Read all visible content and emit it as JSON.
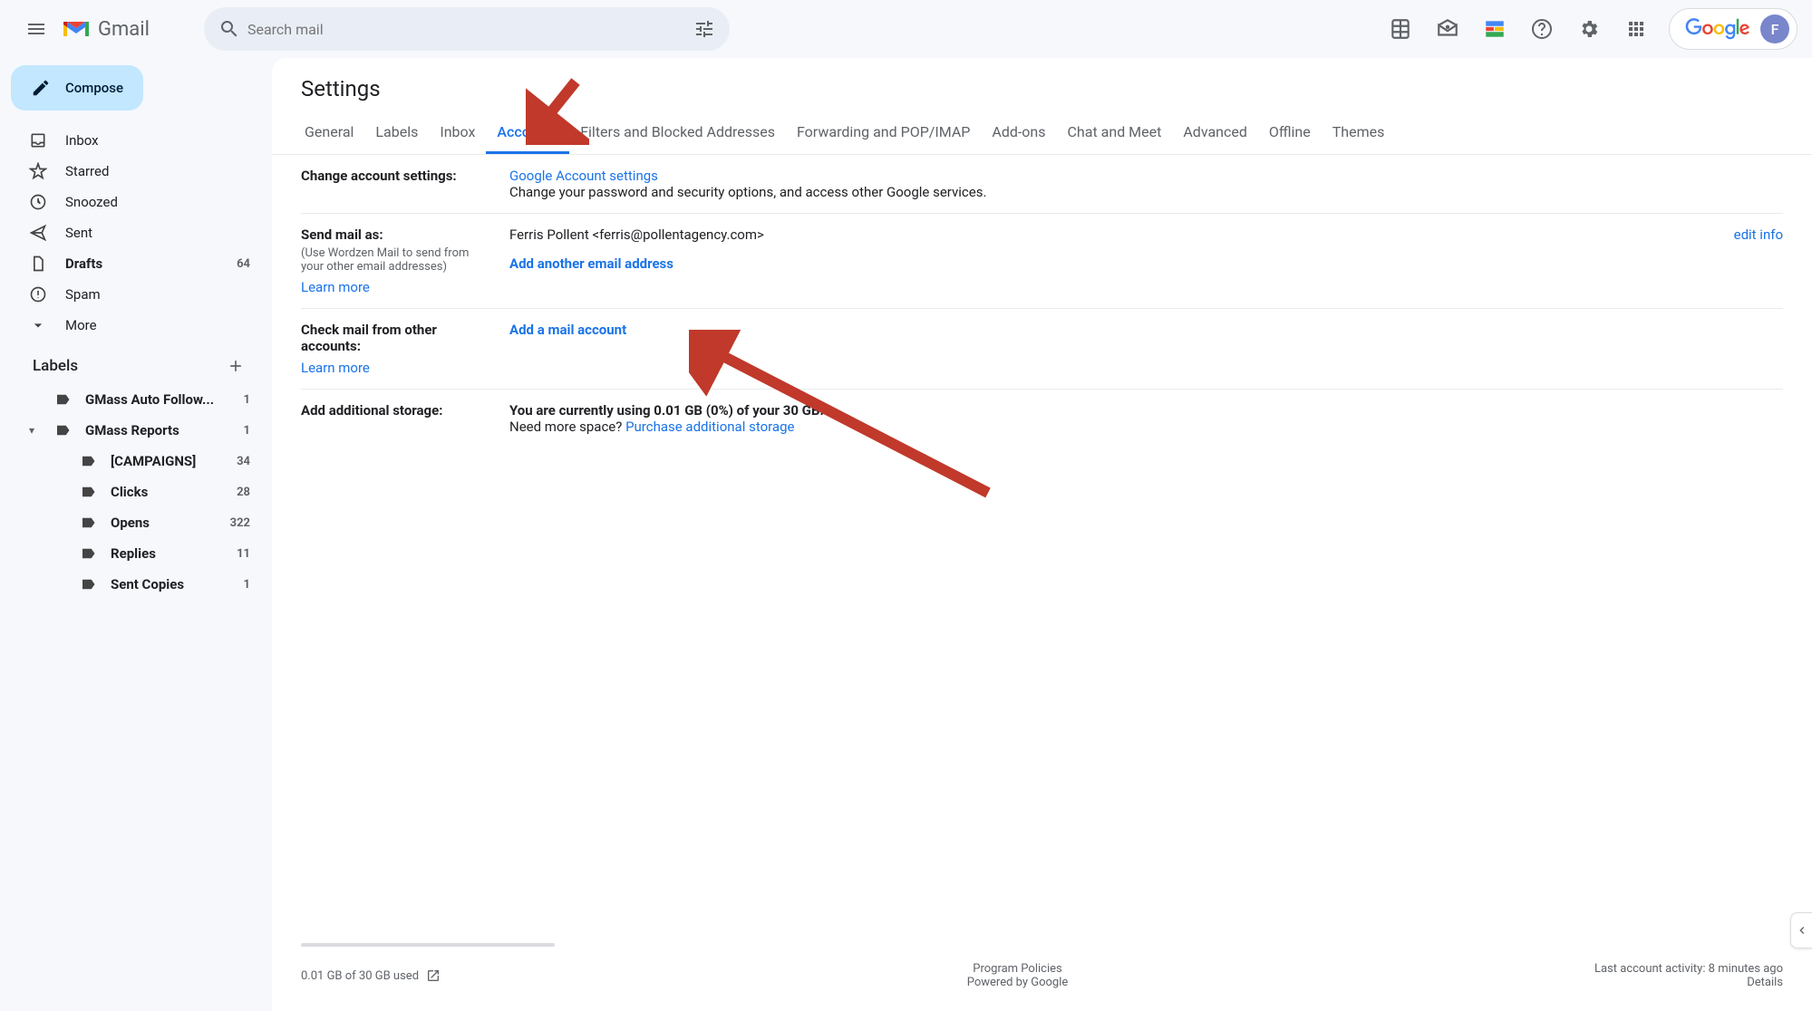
{
  "header": {
    "app_name": "Gmail",
    "search_placeholder": "Search mail",
    "google_text": "Google",
    "avatar_initial": "F"
  },
  "sidebar": {
    "compose": "Compose",
    "nav": [
      {
        "icon": "inbox",
        "label": "Inbox",
        "count": "",
        "bold": false
      },
      {
        "icon": "star",
        "label": "Starred",
        "count": "",
        "bold": false
      },
      {
        "icon": "clock",
        "label": "Snoozed",
        "count": "",
        "bold": false
      },
      {
        "icon": "send",
        "label": "Sent",
        "count": "",
        "bold": false
      },
      {
        "icon": "file",
        "label": "Drafts",
        "count": "64",
        "bold": true
      },
      {
        "icon": "spam",
        "label": "Spam",
        "count": "",
        "bold": false
      },
      {
        "icon": "more",
        "label": "More",
        "count": "",
        "bold": false
      }
    ],
    "labels_header": "Labels",
    "labels": [
      {
        "label": "GMass Auto Follow...",
        "count": "1",
        "indent": false,
        "bold": true,
        "caret": ""
      },
      {
        "label": "GMass Reports",
        "count": "1",
        "indent": false,
        "bold": true,
        "caret": "▾"
      },
      {
        "label": "[CAMPAIGNS]",
        "count": "34",
        "indent": true,
        "bold": true,
        "caret": ""
      },
      {
        "label": "Clicks",
        "count": "28",
        "indent": true,
        "bold": true,
        "caret": ""
      },
      {
        "label": "Opens",
        "count": "322",
        "indent": true,
        "bold": true,
        "caret": ""
      },
      {
        "label": "Replies",
        "count": "11",
        "indent": true,
        "bold": true,
        "caret": ""
      },
      {
        "label": "Sent Copies",
        "count": "1",
        "indent": true,
        "bold": true,
        "caret": ""
      }
    ]
  },
  "settings": {
    "title": "Settings",
    "tabs": [
      "General",
      "Labels",
      "Inbox",
      "Accounts",
      "Filters and Blocked Addresses",
      "Forwarding and POP/IMAP",
      "Add-ons",
      "Chat and Meet",
      "Advanced",
      "Offline",
      "Themes"
    ],
    "active_tab_index": 3,
    "rows": {
      "change_account": {
        "title": "Change account settings:",
        "link": "Google Account settings",
        "desc": "Change your password and security options, and access other Google services."
      },
      "send_as": {
        "title": "Send mail as:",
        "sub": "(Use Wordzen Mail to send from your other email addresses)",
        "learn": "Learn more",
        "identity": "Ferris Pollent <ferris@pollentagency.com>",
        "edit": "edit info",
        "add": "Add another email address"
      },
      "check_mail": {
        "title": "Check mail from other accounts:",
        "learn": "Learn more",
        "add": "Add a mail account"
      },
      "storage": {
        "title": "Add additional storage:",
        "usage": "You are currently using 0.01 GB (0%) of your 30 GB.",
        "need": "Need more space? ",
        "purchase": "Purchase additional storage"
      }
    },
    "footer": {
      "storage_used": "0.01 GB of 30 GB used",
      "program_policies": "Program Policies",
      "powered": "Powered by Google",
      "activity": "Last account activity: 8 minutes ago",
      "details": "Details"
    }
  }
}
